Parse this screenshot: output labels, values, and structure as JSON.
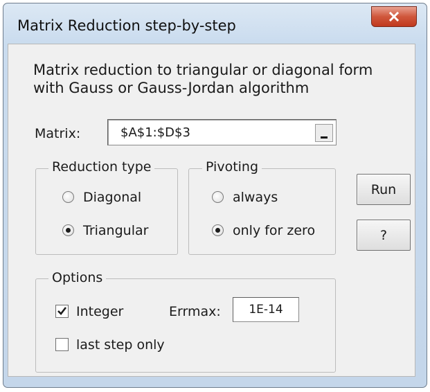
{
  "window": {
    "title": "Matrix Reduction step-by-step",
    "close_icon": "close-icon"
  },
  "description": {
    "line1": "Matrix reduction to triangular or diagonal form",
    "line2": "with Gauss or Gauss-Jordan algorithm"
  },
  "matrix": {
    "label": "Matrix:",
    "value": "$A$1:$D$3",
    "collapse_icon": "collapse-icon"
  },
  "reduction_type": {
    "title": "Reduction type",
    "options": [
      {
        "label": "Diagonal",
        "selected": false
      },
      {
        "label": "Triangular",
        "selected": true
      }
    ]
  },
  "pivoting": {
    "title": "Pivoting",
    "options": [
      {
        "label": "always",
        "selected": false
      },
      {
        "label": "only for zero",
        "selected": true
      }
    ]
  },
  "buttons": {
    "run": "Run",
    "help": "?"
  },
  "options": {
    "title": "Options",
    "integer": {
      "label": "Integer",
      "checked": true
    },
    "last_step_only": {
      "label": "last step only",
      "checked": false
    },
    "errmax": {
      "label": "Errmax:",
      "value": "1E-14"
    }
  },
  "colors": {
    "titlebar": "#c9dbee",
    "close_button": "#c9482c",
    "client": "#f0f0f0"
  }
}
